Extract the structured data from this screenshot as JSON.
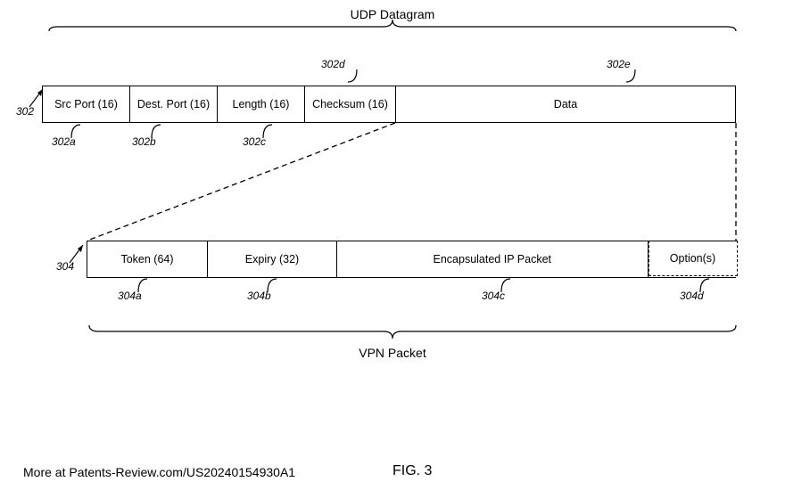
{
  "titles": {
    "top": "UDP Datagram",
    "bottom": "VPN Packet"
  },
  "row302": {
    "ref": "302",
    "fields": [
      {
        "label": "Src Port (16)",
        "ref": "302a"
      },
      {
        "label": "Dest. Port (16)",
        "ref": "302b"
      },
      {
        "label": "Length (16)",
        "ref": "302c"
      },
      {
        "label": "Checksum (16)",
        "ref": "302d"
      },
      {
        "label": "Data",
        "ref": "302e"
      }
    ]
  },
  "row304": {
    "ref": "304",
    "fields": [
      {
        "label": "Token (64)",
        "ref": "304a"
      },
      {
        "label": "Expiry (32)",
        "ref": "304b"
      },
      {
        "label": "Encapsulated IP Packet",
        "ref": "304c"
      },
      {
        "label": "Option(s)",
        "ref": "304d"
      }
    ]
  },
  "figure": "FIG. 3",
  "footer": "More at Patents-Review.com/US20240154930A1"
}
